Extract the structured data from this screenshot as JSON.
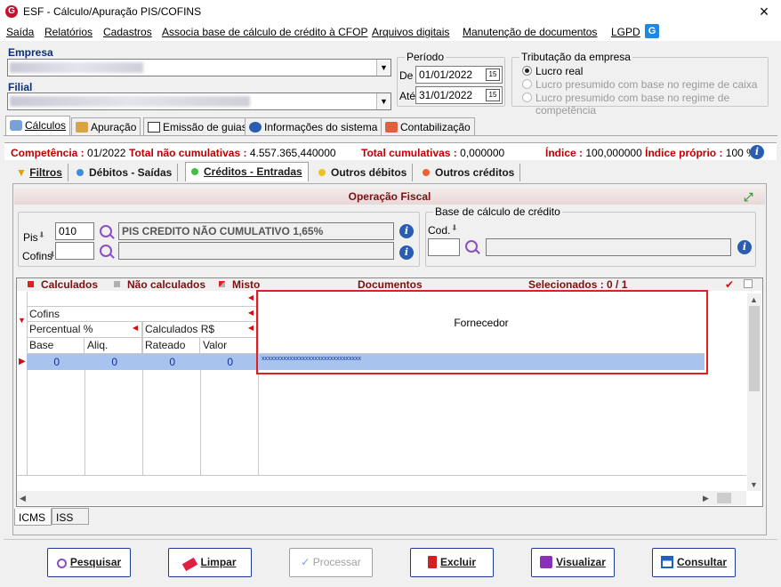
{
  "window": {
    "title": "ESF - Cálculo/Apuração PIS/COFINS",
    "logo": "G",
    "close": "×"
  },
  "menu": [
    "Saída",
    "Relatórios",
    "Cadastros",
    "Associa base de cálculo de crédito à CFOP",
    "Arquivos digitais",
    "Manutenção de documentos",
    "LGPD"
  ],
  "menu_icon": "G",
  "empresa": {
    "label": "Empresa"
  },
  "filial": {
    "label": "Filial"
  },
  "periodo": {
    "title": "Período",
    "de_label": "De",
    "de_value": "01/01/2022",
    "ate_label": "Até",
    "ate_value": "31/01/2022",
    "cal": "15"
  },
  "tributacao": {
    "title": "Tributação da empresa",
    "options": [
      "Lucro real",
      "Lucro presumido com base no regime de caixa",
      "Lucro presumido com base no regime de competência"
    ],
    "selected": "Lucro real"
  },
  "tabs": [
    "Cálculos",
    "Apuração",
    "Emissão de guias",
    "Informações do sistema",
    "Contabilização"
  ],
  "info": {
    "competencia_label": "Competência :",
    "competencia_value": "01/2022",
    "total_nc_label": "Total não cumulativas :",
    "total_nc_value": "4.557.365,440000",
    "total_c_label": "Total cumulativas :",
    "total_c_value": "0,000000",
    "indice_label": "Índice :",
    "indice_value": "100,000000",
    "indice_proprio_label": "Índice próprio :",
    "indice_proprio_value": "100 %"
  },
  "subtabs": [
    "Filtros",
    "Débitos - Saídas",
    "Créditos - Entradas",
    "Outros débitos",
    "Outros créditos"
  ],
  "operacao": {
    "header": "Operação Fiscal",
    "pis_label": "Pis",
    "pis_code": "010",
    "pis_desc": "PIS CREDITO NÃO CUMULATIVO 1,65%",
    "cofins_label": "Cofins",
    "cofins_code": "",
    "cofins_desc": "",
    "base_title": "Base de cálculo de crédito",
    "cod_label": "Cod.",
    "cod_value": "",
    "base_desc": ""
  },
  "grid": {
    "legend_calculados": "Calculados",
    "legend_nao_calculados": "Não calculados",
    "legend_misto": "Misto",
    "documentos": "Documentos",
    "selecionados": "Selecionados : 0 / 1",
    "cofins": "Cofins",
    "percentual": "Percentual %",
    "calculados_rs": "Calculados R$",
    "col_base": "Base",
    "col_aliq": "Aliq.",
    "col_rateado": "Rateado",
    "col_valor": "Valor",
    "fornecedor": "Fornecedor",
    "row": {
      "base": "0",
      "aliq": "0",
      "rateado": "0",
      "valor": "0",
      "fornecedor": "xxxxxxxxxxxxxxxxxxxxxxxxxxxxxxxx"
    }
  },
  "bottom_tabs": [
    "ICMS",
    "ISS"
  ],
  "buttons": {
    "pesquisar": "Pesquisar",
    "limpar": "Limpar",
    "processar": "Processar",
    "excluir": "Excluir",
    "visualizar": "Visualizar",
    "consultar": "Consultar"
  },
  "colors": {
    "accent_red": "#c00000",
    "grid_sel": "#a8c4ee",
    "highlight_border": "#e02020"
  }
}
